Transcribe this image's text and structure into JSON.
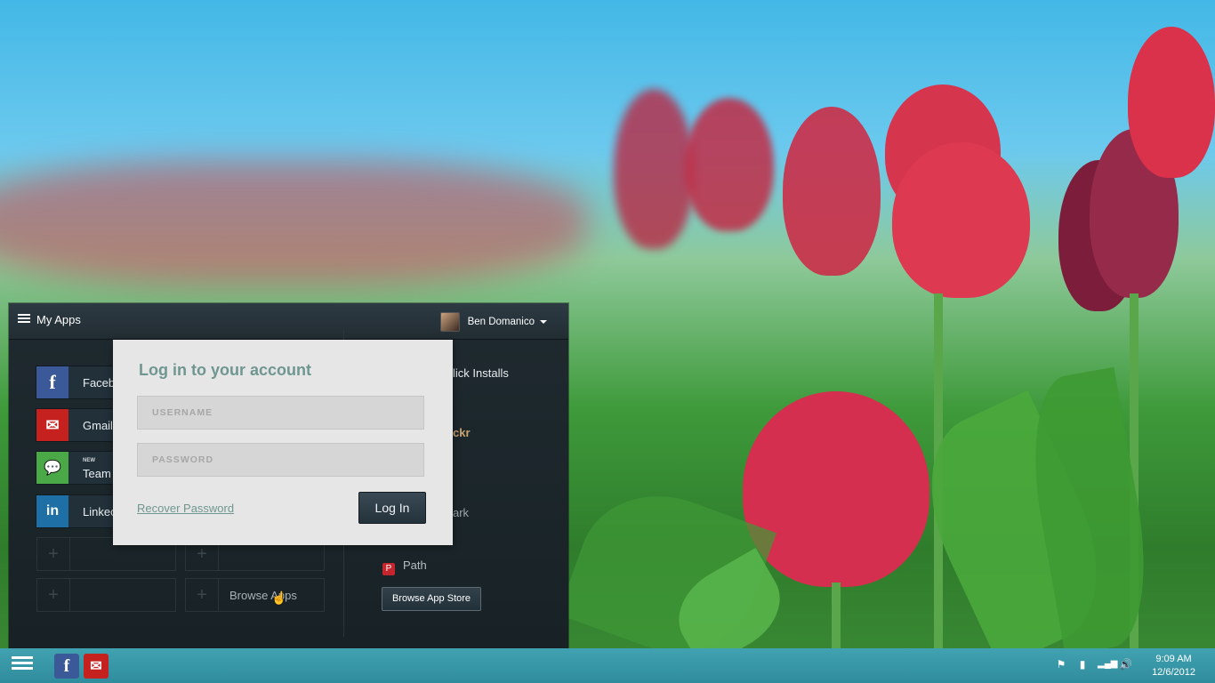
{
  "window": {
    "title": "My Apps",
    "user_name": "Ben Domanico"
  },
  "tiles": [
    {
      "label": "Faceb",
      "icon": "facebook-icon",
      "color": "#3b5998"
    },
    {
      "label": "Gmail",
      "icon": "gmail-icon",
      "color": "#c5221f"
    },
    {
      "label": "Team",
      "badge": "NEW",
      "icon": "chat-icon",
      "color": "#4aa847"
    },
    {
      "label": "Linkec",
      "icon": "linkedin-icon",
      "color": "#1d6fa5"
    }
  ],
  "empty_tiles": {
    "browse_label": "Browse Apps"
  },
  "right_panel": {
    "items": [
      "lick Installs",
      "ckr",
      "ark",
      "Path"
    ],
    "store_button": "Browse App Store"
  },
  "login": {
    "title": "Log in to your account",
    "username_placeholder": "USERNAME",
    "password_placeholder": "PASSWORD",
    "recover_label": "Recover Password",
    "button_label": "Log In"
  },
  "taskbar": {
    "time": "9:09 AM",
    "date": "12/6/2012"
  },
  "colors": {
    "accent": "#6f9690",
    "taskbar": "#3a9aab"
  }
}
